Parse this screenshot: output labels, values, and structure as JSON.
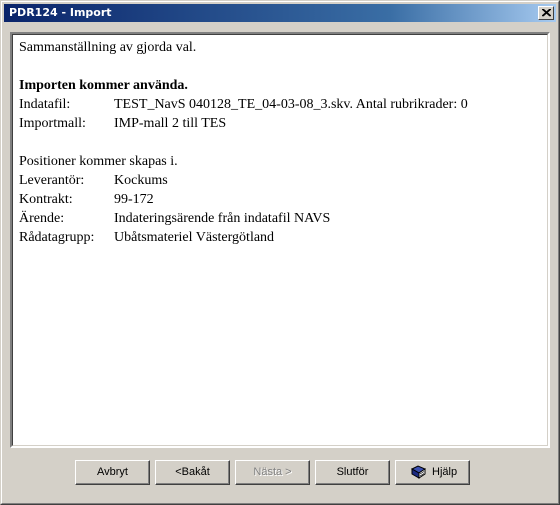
{
  "window": {
    "title": "PDR124 - Import"
  },
  "summary": {
    "intro": "Sammanställning av gjorda val.",
    "heading": "Importen kommer använda.",
    "rows1": [
      {
        "label": "Indatafil:",
        "value": "TEST_NavS 040128_TE_04-03-08_3.skv. Antal rubrikrader: 0"
      },
      {
        "label": "Importmall:",
        "value": "IMP-mall 2 till  TES"
      }
    ],
    "positions_heading": "Positioner kommer skapas i.",
    "rows2": [
      {
        "label": "Leverantör:",
        "value": "Kockums"
      },
      {
        "label": "Kontrakt:",
        "value": "99-172"
      },
      {
        "label": "Ärende:",
        "value": "Indateringsärende från indatafil NAVS"
      },
      {
        "label": "Rådatagrupp:",
        "value": "Ubåtsmateriel Västergötland"
      }
    ]
  },
  "buttons": {
    "cancel": "Avbryt",
    "back": "<Bakåt",
    "next": "Nästa >",
    "finish": "Slutför",
    "help": "Hjälp"
  }
}
